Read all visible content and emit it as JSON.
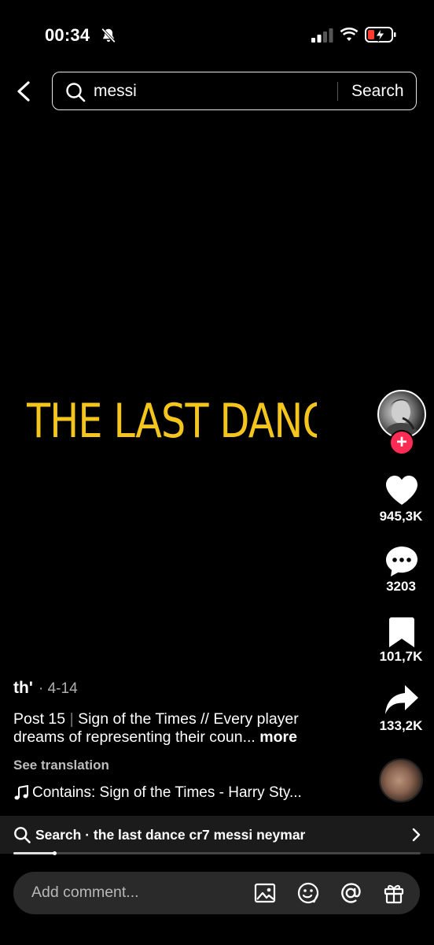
{
  "status_bar": {
    "time": "00:34",
    "icons": [
      "bell-muted-icon",
      "signal-icon",
      "wifi-icon",
      "battery-charging-icon"
    ]
  },
  "search": {
    "query": "messi",
    "button_label": "Search",
    "icons": [
      "back-arrow-icon",
      "search-icon"
    ]
  },
  "video": {
    "overlay_text": "THE LAST DANCE",
    "colors": {
      "overlay_text": "#f4c51c",
      "follow": "#fe2c55"
    }
  },
  "actions": {
    "like_count": "945,3K",
    "comment_count": "3203",
    "bookmark_count": "101,7K",
    "share_count": "133,2K",
    "follow_label": "+",
    "icons": [
      "avatar",
      "heart-icon",
      "comment-icon",
      "bookmark-icon",
      "share-icon",
      "music-disc"
    ]
  },
  "caption": {
    "author": "th'",
    "date": "· 4-14",
    "post_label": "Post 15",
    "separator": "|",
    "text": "Sign of the Times // Every player dreams of representing their coun...",
    "more_label": "more",
    "translation_label": "See translation",
    "music": "Contains: Sign of the Times - Harry Sty..."
  },
  "suggestion": {
    "label": "Search · the last dance cr7 messi neymar",
    "progress": 0.1
  },
  "comment_bar": {
    "placeholder": "Add comment...",
    "icons": [
      "image-icon",
      "emoji-icon",
      "mention-icon",
      "gift-icon"
    ]
  }
}
